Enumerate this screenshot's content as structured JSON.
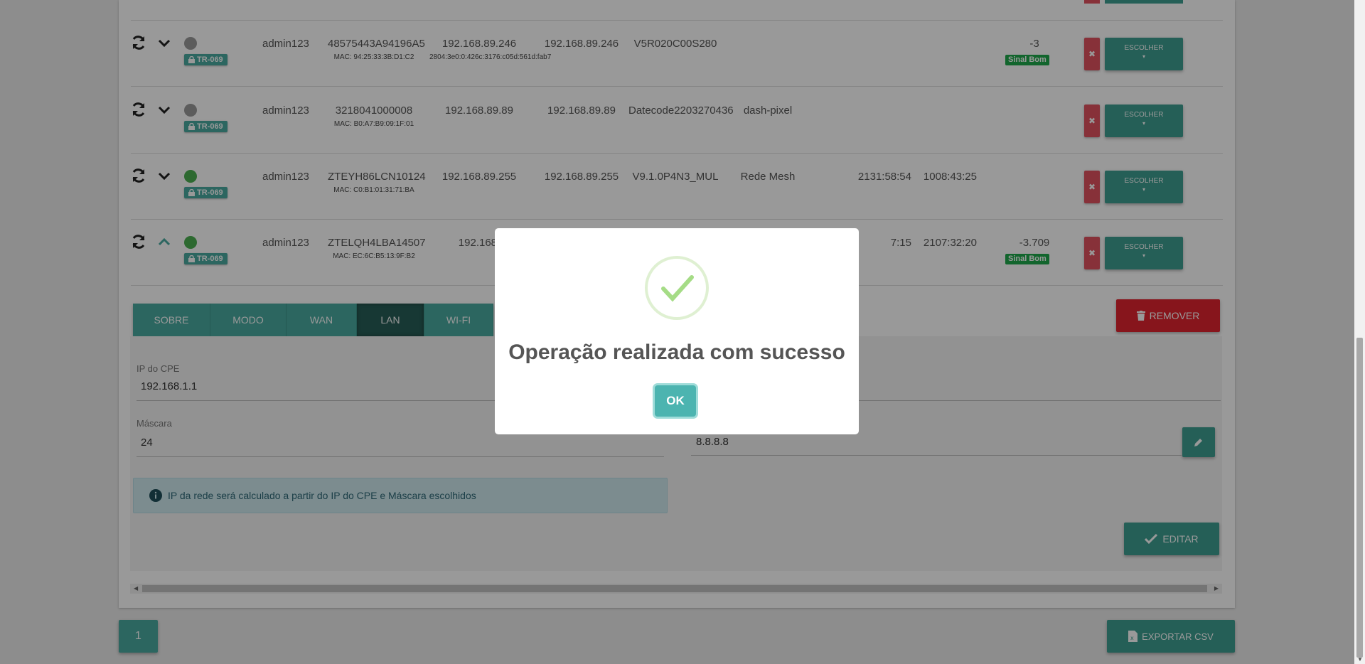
{
  "rows": [
    {
      "user": "admin123",
      "serial": "48575443A94196A5",
      "mac": "MAC: 94:25:33:3B:D1:C2",
      "ip1": "192.168.89.246",
      "ip2": "192.168.89.246",
      "ipv6": "2804:3e0:0:426c:3176:c05d:561d:fab7",
      "firmware": "V5R020C00S280",
      "col6": "",
      "col7": "",
      "col8": "",
      "signal": "-3",
      "signal_label": "Sinal Bom",
      "status": "gray",
      "expanded": false
    },
    {
      "user": "admin123",
      "serial": "3218041000008",
      "mac": "MAC: B0:A7:B9:09:1F:01",
      "ip1": "192.168.89.89",
      "ip2": "192.168.89.89",
      "ipv6": "",
      "firmware": "Datecode2203270436",
      "col6": "dash-pixel",
      "col7": "",
      "col8": "",
      "signal": "",
      "signal_label": "",
      "status": "gray",
      "expanded": false
    },
    {
      "user": "admin123",
      "serial": "ZTEYH86LCN10124",
      "mac": "MAC: C0:B1:01:31:71:BA",
      "ip1": "192.168.89.255",
      "ip2": "192.168.89.255",
      "ipv6": "",
      "firmware": "V9.1.0P4N3_MUL",
      "col6": "Rede Mesh",
      "col7": "2131:58:54",
      "col8": "1008:43:25",
      "signal": "",
      "signal_label": "",
      "status": "green",
      "expanded": false
    },
    {
      "user": "admin123",
      "serial": "ZTELQH4LBA14507",
      "mac": "MAC: EC:6C:B5:13:9F:B2",
      "ip1": "192.168.",
      "ip2": "",
      "ipv6": "",
      "firmware": "",
      "col6": "",
      "col7": "7:15",
      "col8": "2107:32:20",
      "signal": "-3.709",
      "signal_label": "Sinal Bom",
      "status": "green",
      "expanded": true
    }
  ],
  "badge_label": "TR-069",
  "choose_label": "ESCOLHER",
  "tabs": [
    "SOBRE",
    "MODO",
    "WAN",
    "LAN",
    "WI-FI"
  ],
  "active_tab": "LAN",
  "remove_label": "REMOVER",
  "form": {
    "cpe_ip_label": "IP do CPE",
    "cpe_ip_value": "192.168.1.1",
    "mask_label": "Máscara",
    "mask_value": "24",
    "dns_value": "8.8.8.8"
  },
  "info_text": "IP da rede será calculado a partir do IP do CPE e Máscara escolhidos",
  "edit_label": "EDITAR",
  "page_number": "1",
  "export_label": "EXPORTAR CSV",
  "modal": {
    "title": "Operação realizada com sucesso",
    "ok_label": "OK"
  },
  "colors": {
    "teal": "#4aaba0",
    "teal_dark": "#3f9e91",
    "tab_active": "#275e57",
    "danger": "#e2232f",
    "success": "#1ea84b"
  }
}
